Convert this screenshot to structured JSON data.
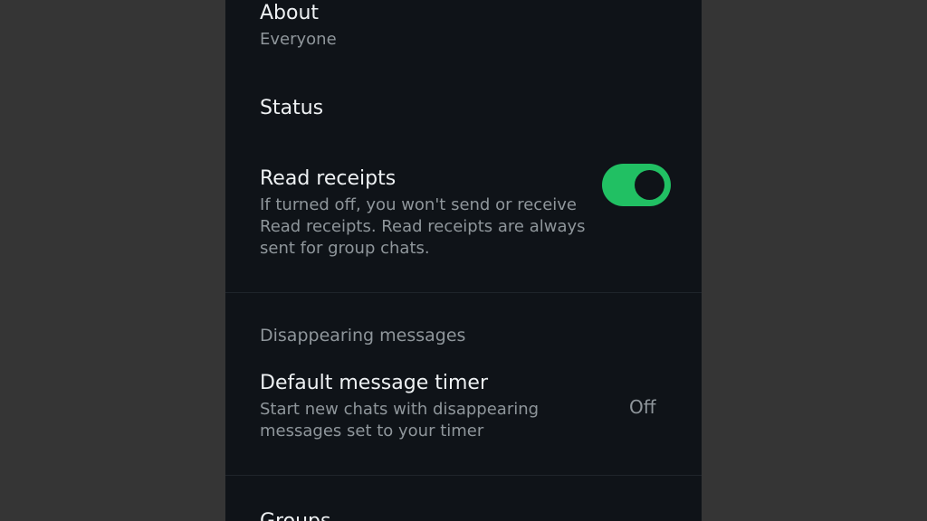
{
  "settings": {
    "about": {
      "label": "About",
      "value": "Everyone"
    },
    "status": {
      "label": "Status"
    },
    "read_receipts": {
      "label": "Read receipts",
      "description": "If turned off, you won't send or receive Read receipts. Read receipts are always sent for group chats.",
      "enabled": true
    },
    "disappearing_section": {
      "label": "Disappearing messages"
    },
    "default_timer": {
      "label": "Default message timer",
      "description": "Start new chats with disappearing messages set to your timer",
      "value": "Off"
    },
    "groups": {
      "label": "Groups"
    }
  },
  "colors": {
    "background": "#0f1318",
    "outer_background": "#353535",
    "toggle_on": "#21c063",
    "primary_text": "#eef1f3",
    "secondary_text": "#8f969b"
  }
}
